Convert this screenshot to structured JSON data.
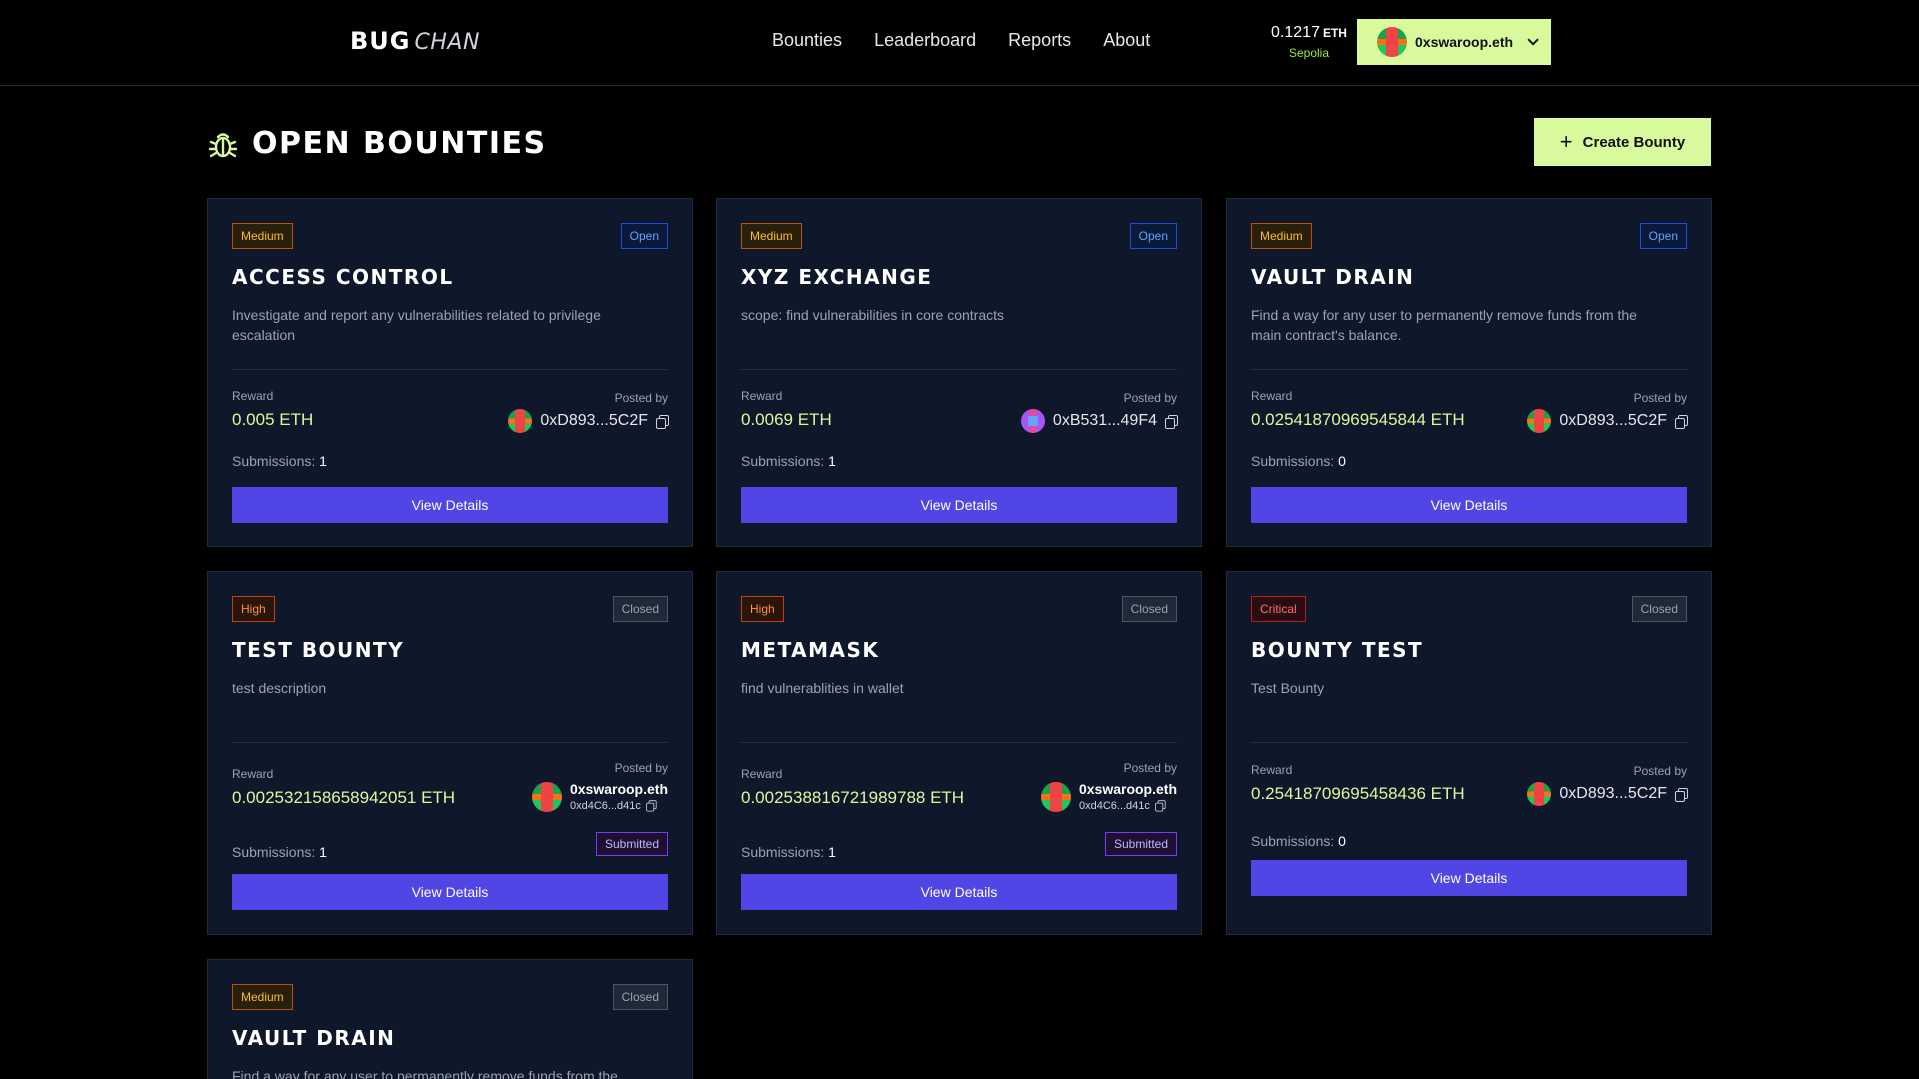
{
  "header": {
    "logo_bold": "BUG",
    "logo_light": "CHAN",
    "nav": [
      "Bounties",
      "Leaderboard",
      "Reports",
      "About"
    ],
    "balance_amount": "0.1217",
    "balance_unit": "ETH",
    "network": "Sepolia",
    "wallet_name": "0xswaroop.eth"
  },
  "page": {
    "title": "OPEN BOUNTIES",
    "create_label": "Create Bounty"
  },
  "labels": {
    "reward": "Reward",
    "posted_by": "Posted by",
    "submissions": "Submissions:",
    "view": "View Details",
    "submitted": "Submitted"
  },
  "cards": [
    {
      "severity": "Medium",
      "status": "Open",
      "title": "ACCESS CONTROL",
      "desc": "Investigate and report any vulnerabilities related to privilege escalation",
      "reward": "0.005 ETH",
      "poster": "0xD893...5C2F",
      "submissions": "1"
    },
    {
      "severity": "Medium",
      "status": "Open",
      "title": "XYZ EXCHANGE",
      "desc": "scope: find vulnerabilities in core contracts",
      "reward": "0.0069 ETH",
      "poster": "0xB531...49F4",
      "submissions": "1"
    },
    {
      "severity": "Medium",
      "status": "Open",
      "title": "VAULT DRAIN",
      "desc": "Find a way for any user to permanently remove funds from the main contract's balance.",
      "reward": "0.02541870969545844 ETH",
      "poster": "0xD893...5C2F",
      "submissions": "0"
    },
    {
      "severity": "High",
      "status": "Closed",
      "title": "TEST BOUNTY",
      "desc": "test description",
      "reward": "0.002532158658942051 ETH",
      "poster_ens": "0xswaroop.eth",
      "poster_short": "0xd4C6...d41c",
      "submissions": "1"
    },
    {
      "severity": "High",
      "status": "Closed",
      "title": "METAMASK",
      "desc": "find vulnerablities in wallet",
      "reward": "0.002538816721989788 ETH",
      "poster_ens": "0xswaroop.eth",
      "poster_short": "0xd4C6...d41c",
      "submissions": "1"
    },
    {
      "severity": "Critical",
      "status": "Closed",
      "title": "BOUNTY TEST",
      "desc": "Test Bounty",
      "reward": "0.25418709695458436 ETH",
      "poster": "0xD893...5C2F",
      "submissions": "0"
    },
    {
      "severity": "Medium",
      "status": "Closed",
      "title": "VAULT DRAIN",
      "desc": "Find a way for any user to permanently remove funds from the main contract's balance."
    }
  ]
}
